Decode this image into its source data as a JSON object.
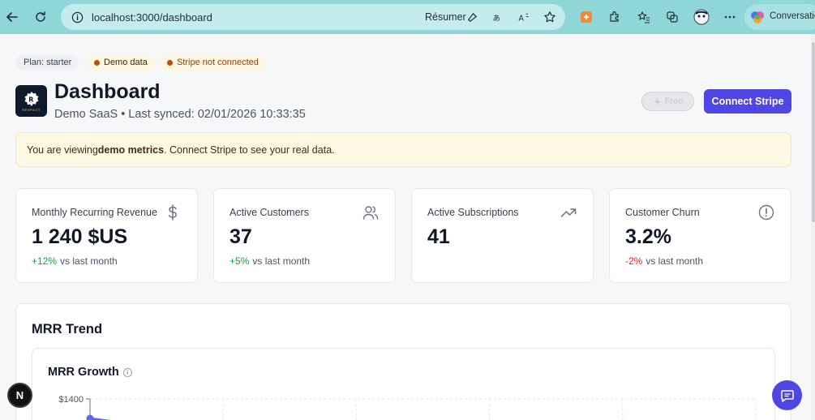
{
  "browser": {
    "url": "localhost:3000/dashboard",
    "summarize_label": "Résumer",
    "copilot_label": "Conversation"
  },
  "badges": {
    "plan": "Plan: starter",
    "demo": "Demo data",
    "stripe": "Stripe not connected"
  },
  "header": {
    "logo_text": "REVPILOT",
    "title": "Dashboard",
    "subtitle": "Demo SaaS • Last synced: 02/01/2026 10:33:35",
    "plan_button": "Free",
    "connect_button": "Connect Stripe"
  },
  "alert": {
    "prefix": "You are viewing ",
    "highlight": "demo metrics",
    "suffix": ". Connect Stripe to see your real data."
  },
  "metrics": [
    {
      "label": "Monthly Recurring Revenue",
      "value": "1 240 $US",
      "change": "+12%",
      "change_suffix": "vs last month",
      "icon": "dollar-icon"
    },
    {
      "label": "Active Customers",
      "value": "37",
      "change": "+5%",
      "change_suffix": "vs last month",
      "icon": "users-icon"
    },
    {
      "label": "Active Subscriptions",
      "value": "41",
      "icon": "trending-up-icon"
    },
    {
      "label": "Customer Churn",
      "value": "3.2%",
      "change": "-2%",
      "change_suffix": "vs last month",
      "icon": "alert-circle-icon"
    }
  ],
  "trend": {
    "title": "MRR Trend",
    "chart_title": "MRR Growth"
  },
  "chart_data": {
    "type": "line",
    "title": "MRR Growth",
    "y_ticks": [
      "$1400"
    ],
    "series": [
      {
        "values": [
          1400
        ]
      }
    ],
    "grid": true
  },
  "floating": {
    "next_badge": "N"
  },
  "colors": {
    "accent": "#4f46e5",
    "browser_bar": "#8fd6d6",
    "positive": "#16a34a",
    "negative": "#dc2626",
    "warning_dot": "#b45309"
  }
}
